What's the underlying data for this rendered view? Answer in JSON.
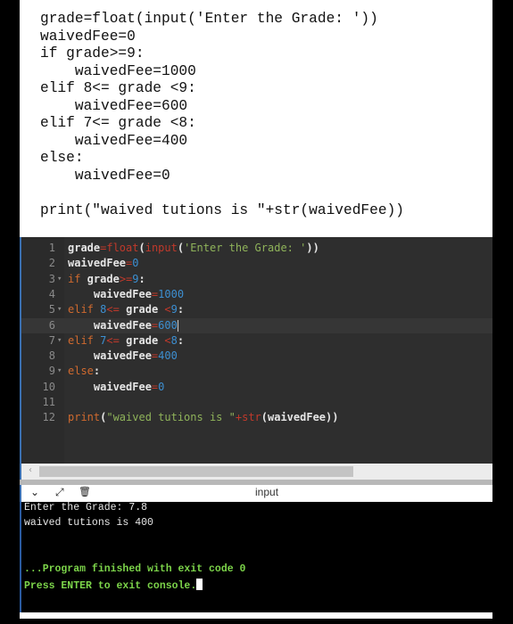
{
  "snippet": {
    "lines": [
      "grade=float(input('Enter the Grade: '))",
      "waivedFee=0",
      "if grade>=9:",
      "    waivedFee=1000",
      "elif 8<= grade <9:",
      "    waivedFee=600",
      "elif 7<= grade <8:",
      "    waivedFee=400",
      "else:",
      "    waivedFee=0",
      "",
      "print(\"waived tutions is \"+str(waivedFee))"
    ]
  },
  "editor": {
    "line_numbers": [
      "1",
      "2",
      "3",
      "4",
      "5",
      "6",
      "7",
      "8",
      "9",
      "10",
      "11",
      "12"
    ],
    "active_line": 6,
    "foldable_lines": [
      3,
      5,
      7,
      9
    ],
    "fold_marker": "▾"
  },
  "scrollbar": {
    "left_arrow": "‹"
  },
  "console_bar": {
    "collapse_icon": "⌄",
    "expand_icon": "⤢",
    "clear_icon": "🗑",
    "title": "input"
  },
  "console": {
    "output": [
      "Enter the Grade: 7.8",
      "waived tutions is 400"
    ],
    "messages": [
      "...Program finished with exit code 0",
      "Press ENTER to exit console."
    ]
  },
  "colors": {
    "keyword": "#d06a2e",
    "builtin": "#c0392b",
    "number": "#3d8fd1",
    "string": "#8fb35a",
    "console_success": "#7cd44a",
    "editor_bg": "#2e2e2e"
  }
}
